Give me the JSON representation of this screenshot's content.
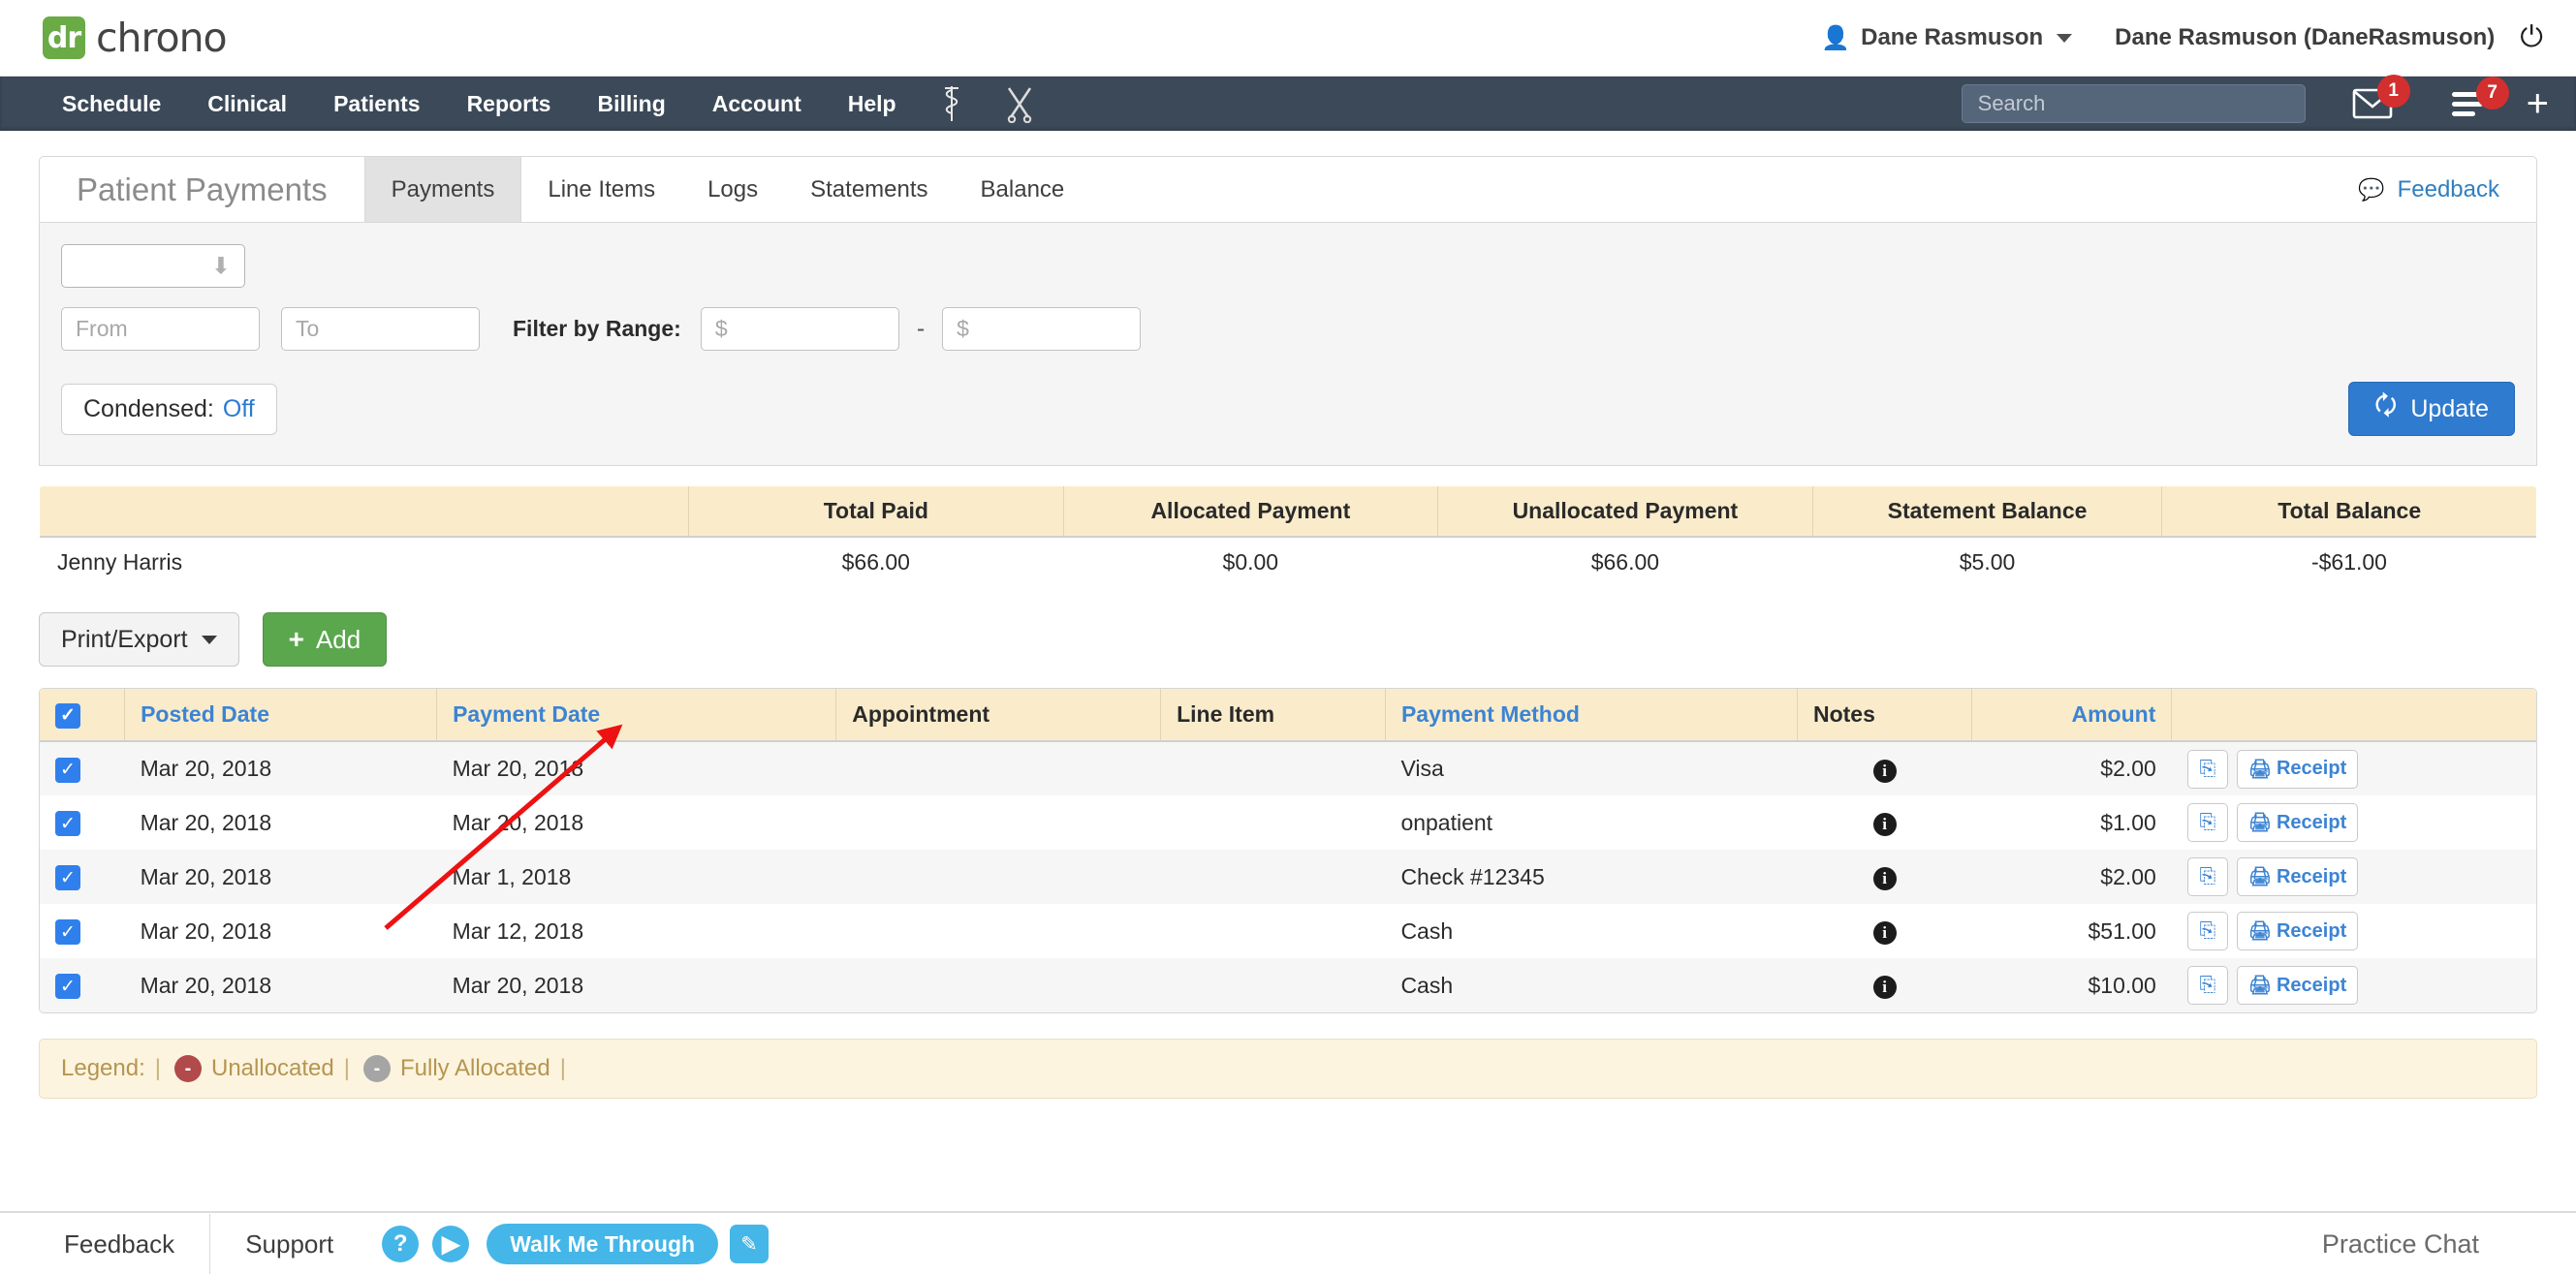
{
  "header": {
    "logo_mark": "dr",
    "logo_text": "chrono",
    "user_menu": "Dane Rasmuson",
    "user_icon": "person-icon",
    "user_full": "Dane Rasmuson (DaneRasmuson)",
    "power_icon": "power-icon"
  },
  "nav": {
    "items": [
      {
        "label": "Schedule"
      },
      {
        "label": "Clinical"
      },
      {
        "label": "Patients"
      },
      {
        "label": "Reports"
      },
      {
        "label": "Billing"
      },
      {
        "label": "Account"
      },
      {
        "label": "Help"
      }
    ],
    "icons": [
      "caduceus-icon",
      "scissors-icon"
    ],
    "search_placeholder": "Search",
    "search_value": "",
    "mail_badge": "1",
    "menu_badge": "7",
    "plus_label": "+"
  },
  "panel": {
    "title": "Patient Payments",
    "tabs": [
      {
        "label": "Payments",
        "active": true
      },
      {
        "label": "Line Items",
        "active": false
      },
      {
        "label": "Logs",
        "active": false
      },
      {
        "label": "Statements",
        "active": false
      },
      {
        "label": "Balance",
        "active": false
      }
    ],
    "feedback": "Feedback"
  },
  "filters": {
    "provider_select_value": "",
    "from_placeholder": "From",
    "from_value": "",
    "to_placeholder": "To",
    "to_value": "",
    "range_label": "Filter by Range:",
    "range_min_placeholder": "$",
    "range_min_value": "",
    "range_dash": "-",
    "range_max_placeholder": "$",
    "range_max_value": "",
    "condensed_label": "Condensed:",
    "condensed_value": "Off",
    "update_label": "Update"
  },
  "summary": {
    "columns": [
      "",
      "Total Paid",
      "Allocated Payment",
      "Unallocated Payment",
      "Statement Balance",
      "Total Balance"
    ],
    "rows": [
      {
        "name": "Jenny Harris",
        "total_paid": "$66.00",
        "allocated_payment": "$0.00",
        "unallocated_payment": "$66.00",
        "statement_balance": "$5.00",
        "total_balance": "-$61.00"
      }
    ]
  },
  "actions": {
    "print_export": "Print/Export",
    "add": "Add"
  },
  "payments_table": {
    "columns": [
      {
        "label": "",
        "kind": "checkbox"
      },
      {
        "label": "Posted Date",
        "kind": "link"
      },
      {
        "label": "Payment Date",
        "kind": "link"
      },
      {
        "label": "Appointment",
        "kind": "plain"
      },
      {
        "label": "Line Item",
        "kind": "plain"
      },
      {
        "label": "Payment Method",
        "kind": "link"
      },
      {
        "label": "Notes",
        "kind": "plain"
      },
      {
        "label": "Amount",
        "kind": "link-num"
      },
      {
        "label": "",
        "kind": "plain"
      }
    ],
    "rows": [
      {
        "checked": true,
        "posted_date": "Mar 20, 2018",
        "payment_date": "Mar 20, 2018",
        "appointment": "",
        "line_item": "",
        "payment_method": "Visa",
        "notes_icon": "info-icon",
        "amount": "$2.00",
        "action_icon": "download-circle-icon",
        "receipt_label": "Receipt"
      },
      {
        "checked": true,
        "posted_date": "Mar 20, 2018",
        "payment_date": "Mar 20, 2018",
        "appointment": "",
        "line_item": "",
        "payment_method": "onpatient",
        "notes_icon": "info-icon",
        "amount": "$1.00",
        "action_icon": "download-circle-icon",
        "receipt_label": "Receipt"
      },
      {
        "checked": true,
        "posted_date": "Mar 20, 2018",
        "payment_date": "Mar 1, 2018",
        "appointment": "",
        "line_item": "",
        "payment_method": "Check #12345",
        "notes_icon": "info-icon",
        "amount": "$2.00",
        "action_icon": "download-circle-icon",
        "receipt_label": "Receipt"
      },
      {
        "checked": true,
        "posted_date": "Mar 20, 2018",
        "payment_date": "Mar 12, 2018",
        "appointment": "",
        "line_item": "",
        "payment_method": "Cash",
        "notes_icon": "info-icon",
        "amount": "$51.00",
        "action_icon": "download-circle-icon",
        "receipt_label": "Receipt"
      },
      {
        "checked": true,
        "posted_date": "Mar 20, 2018",
        "payment_date": "Mar 20, 2018",
        "appointment": "",
        "line_item": "",
        "payment_method": "Cash",
        "notes_icon": "info-icon",
        "amount": "$10.00",
        "action_icon": "download-circle-icon",
        "receipt_label": "Receipt"
      }
    ]
  },
  "legend": {
    "label": "Legend:",
    "sep": "|",
    "items": [
      {
        "color": "#b14a4a",
        "glyph": "-",
        "label": "Unallocated"
      },
      {
        "color": "#a5a5a5",
        "glyph": "-",
        "label": "Fully Allocated"
      }
    ],
    "trailing_sep": "|"
  },
  "footer": {
    "feedback": "Feedback",
    "support": "Support",
    "help_icon": "question-circle-icon",
    "play_icon": "play-circle-icon",
    "walk_me_through": "Walk Me Through",
    "pencil_icon": "pencil-icon",
    "practice_chat": "Practice Chat"
  },
  "annotation": {
    "arrow_color": "#ee1111"
  }
}
